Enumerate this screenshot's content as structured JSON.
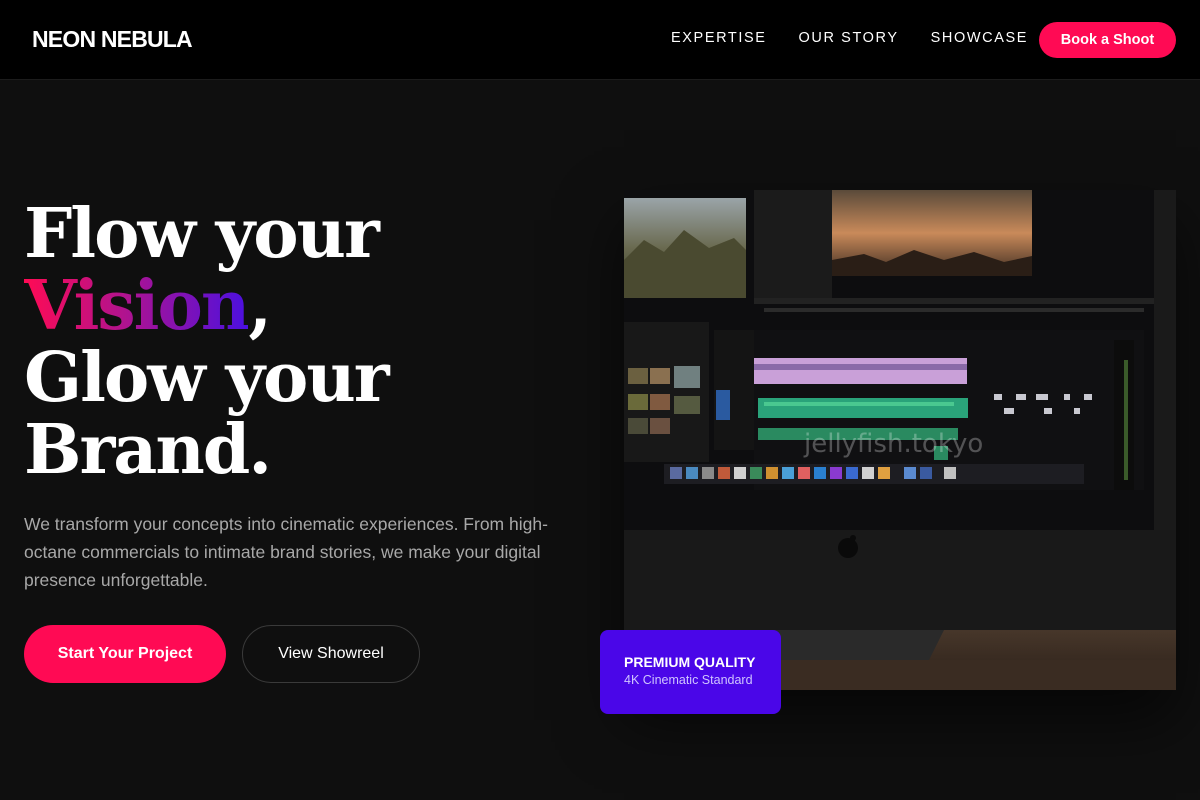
{
  "nav": {
    "logo": "NEON NEBULA",
    "links": [
      "EXPERTISE",
      "OUR STORY",
      "SHOWCASE"
    ],
    "cta": "Book a Shoot"
  },
  "hero": {
    "line1": "Flow your",
    "highlight": "Vision",
    "comma": ",",
    "line3": "Glow your",
    "line4": "Brand.",
    "description": "We transform your concepts into cinematic experiences. From high-octane commercials to intimate brand stories, we make your digital presence unforgettable.",
    "primary_button": "Start Your Project",
    "secondary_button": "View Showreel"
  },
  "image": {
    "watermark": "jellyfish.tokyo"
  },
  "badge": {
    "title": "PREMIUM QUALITY",
    "subtitle": "4K Cinematic Standard"
  },
  "colors": {
    "accent": "#ff0a54",
    "purple": "#4a06e8",
    "background": "#0f0f0f"
  }
}
